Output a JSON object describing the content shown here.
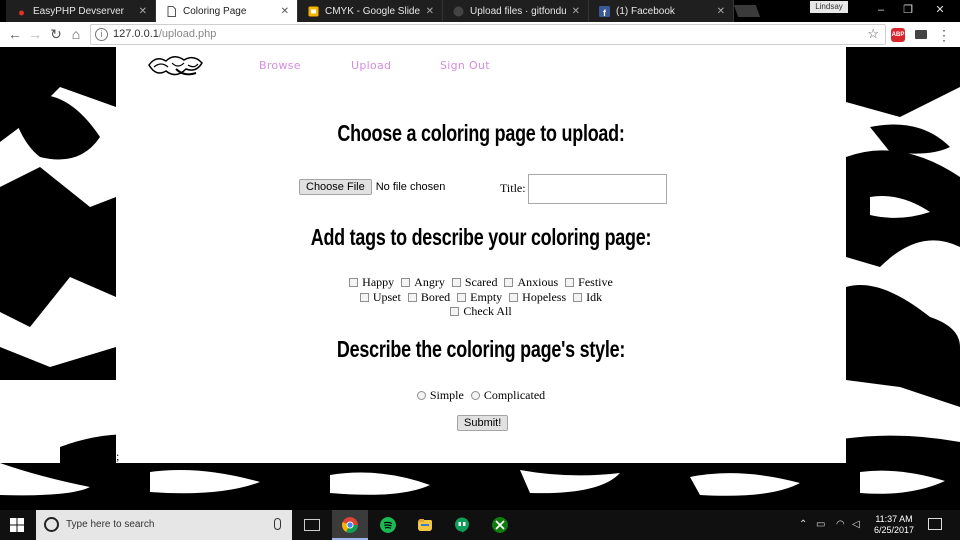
{
  "browser": {
    "tabs": [
      {
        "label": "EasyPHP Devserver",
        "icon": "easyphp-icon",
        "active": false
      },
      {
        "label": "Coloring Page",
        "icon": "page-icon",
        "active": true
      },
      {
        "label": "CMYK - Google Slides",
        "icon": "google-slides-icon",
        "active": false
      },
      {
        "label": "Upload files · gitfondue/",
        "icon": "github-icon",
        "active": false
      },
      {
        "label": "(1) Facebook",
        "icon": "facebook-icon",
        "active": false
      }
    ],
    "user_name": "Lindsay",
    "url_host": "127.0.0.1",
    "url_path": "/upload.php",
    "extension_abp": "ABP"
  },
  "page": {
    "nav": {
      "browse": "Browse",
      "upload": "Upload",
      "signout": "Sign Out"
    },
    "heading_upload": "Choose a coloring page to upload:",
    "choose_file_label": "Choose File",
    "no_file_text": "No file chosen",
    "title_label": "Title:",
    "title_value": "",
    "heading_tags": "Add tags to describe your coloring page:",
    "tags": {
      "happy": "Happy",
      "angry": "Angry",
      "scared": "Scared",
      "anxious": "Anxious",
      "festive": "Festive",
      "upset": "Upset",
      "bored": "Bored",
      "empty": "Empty",
      "hopeless": "Hopeless",
      "idk": "Idk",
      "check_all": "Check All"
    },
    "heading_style": "Describe the coloring page's style:",
    "styles": {
      "simple": "Simple",
      "complicated": "Complicated"
    },
    "submit_label": "Submit!",
    "stray_text": ";"
  },
  "taskbar": {
    "search_placeholder": "Type here to search",
    "time": "11:37 AM",
    "date": "6/25/2017",
    "pinned": [
      "chrome-icon",
      "spotify-icon",
      "file-explorer-icon",
      "hangouts-icon",
      "xbox-icon"
    ]
  },
  "colors": {
    "nav_link": "#d58de0",
    "taskbar": "#101010",
    "abp_red": "#d9262c"
  }
}
